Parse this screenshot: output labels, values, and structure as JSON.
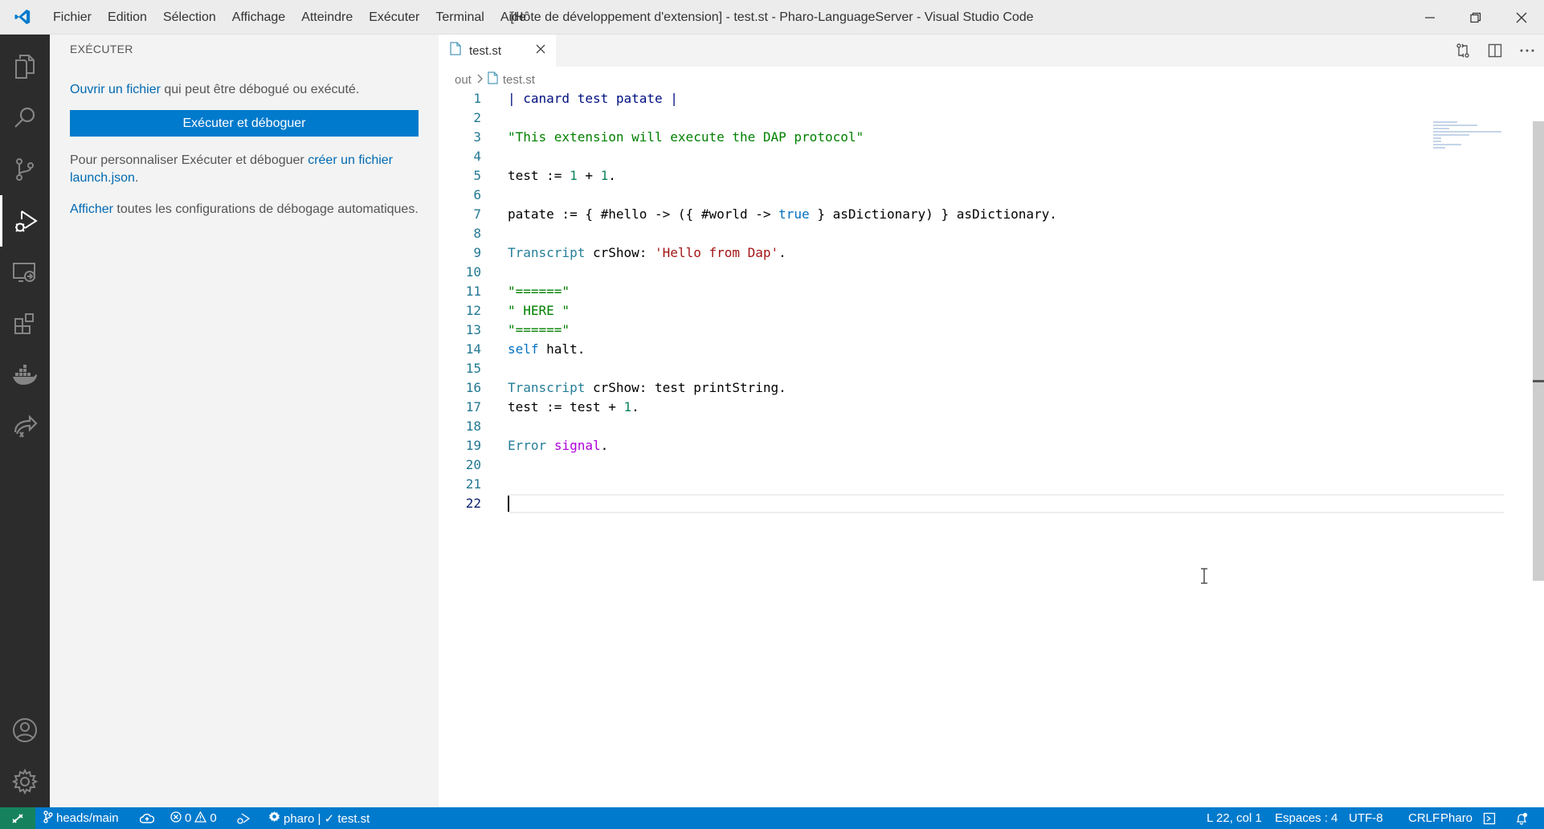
{
  "window": {
    "title": "[Hôte de développement d'extension] - test.st - Pharo-LanguageServer - Visual Studio Code"
  },
  "menu": {
    "items": [
      "Fichier",
      "Edition",
      "Sélection",
      "Affichage",
      "Atteindre",
      "Exécuter",
      "Terminal",
      "Aide"
    ]
  },
  "activity_bar": {
    "items": [
      "explorer-icon",
      "search-icon",
      "source-control-icon",
      "run-debug-icon",
      "remote-explorer-icon",
      "extensions-icon",
      "docker-icon",
      "live-share-icon"
    ],
    "bottom": [
      "account-icon",
      "settings-gear-icon"
    ],
    "active": "run-debug-icon"
  },
  "sidebar": {
    "title": "EXÉCUTER",
    "open_file_link": "Ouvrir un fichier",
    "open_file_text": " qui peut être débogué ou exécuté.",
    "run_button": "Exécuter et déboguer",
    "customize_text": "Pour personnaliser Exécuter et déboguer ",
    "customize_link": "créer un fichier launch.json",
    "customize_end": ".",
    "show_link": "Afficher",
    "show_text": " toutes les configurations de débogage automatiques."
  },
  "editor": {
    "tab_label": "test.st",
    "breadcrumb": [
      "out",
      "test.st"
    ],
    "current_line": 22,
    "lines": [
      [
        [
          "tk-var",
          "| canard test patate |"
        ]
      ],
      [],
      [
        [
          "tk-cmt",
          "\"This extension will execute the DAP protocol\""
        ]
      ],
      [],
      [
        [
          "",
          "test := "
        ],
        [
          "tk-num",
          "1"
        ],
        [
          "",
          " + "
        ],
        [
          "tk-num",
          "1"
        ],
        [
          "",
          "."
        ]
      ],
      [],
      [
        [
          "",
          "patate := { #hello -> ({ #world -> "
        ],
        [
          "tk-kw",
          "true"
        ],
        [
          "",
          " } asDictionary) } asDictionary."
        ]
      ],
      [],
      [
        [
          "tk-cls",
          "Transcript"
        ],
        [
          "",
          " crShow: "
        ],
        [
          "tk-str",
          "'Hello from Dap'"
        ],
        [
          "",
          "."
        ]
      ],
      [],
      [
        [
          "tk-cmt",
          "\"======\""
        ]
      ],
      [
        [
          "tk-cmt",
          "\" HERE \""
        ]
      ],
      [
        [
          "tk-cmt",
          "\"======\""
        ]
      ],
      [
        [
          "tk-kw",
          "self"
        ],
        [
          "",
          " halt."
        ]
      ],
      [],
      [
        [
          "tk-cls",
          "Transcript"
        ],
        [
          "",
          " crShow: test printString."
        ]
      ],
      [
        [
          "",
          "test := test + "
        ],
        [
          "tk-num",
          "1"
        ],
        [
          "",
          "."
        ]
      ],
      [],
      [
        [
          "tk-cls",
          "Error"
        ],
        [
          "",
          " "
        ],
        [
          "tk-sig",
          "signal"
        ],
        [
          "",
          "."
        ]
      ],
      [],
      [],
      []
    ]
  },
  "status_bar": {
    "branch": "heads/main",
    "errors": "0",
    "warnings": "0",
    "pharo": "pharo | ✓ test.st",
    "position": "L 22, col 1",
    "spaces": "Espaces : 4",
    "encoding": "UTF-8",
    "eol": "CRLF",
    "language": "Pharo"
  },
  "colors": {
    "accent": "#007acc",
    "remote": "#16825d",
    "activity_bar": "#2c2c2c"
  }
}
